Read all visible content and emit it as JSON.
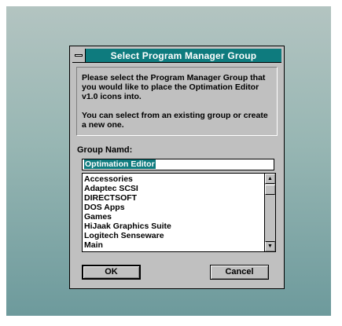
{
  "dialog": {
    "title": "Select Program Manager Group",
    "message_line1": "Please select the Program Manager Group that you would like to place the Optimation Editor v1.0 icons into.",
    "message_line2": "You can select from an existing group or create a new one.",
    "group_label": "Group Namd:",
    "group_value": "Optimation Editor",
    "groups": [
      "Accessories",
      "Adaptec SCSI",
      "DIRECTSOFT",
      "DOS Apps",
      "Games",
      "HiJaak Graphics Suite",
      "Logitech Senseware",
      "Main"
    ],
    "ok_label": "OK",
    "cancel_label": "Cancel"
  },
  "icons": {
    "system_menu": "system-menu-icon",
    "scroll_up": "arrow-up-icon",
    "scroll_down": "arrow-down-icon"
  },
  "colors": {
    "title_bar": "#0e7b7e",
    "dialog_face": "#c0c0c0",
    "desktop_top": "#b3c4c1",
    "desktop_bottom": "#6d9a9c",
    "selection": "#0e7b7e"
  }
}
